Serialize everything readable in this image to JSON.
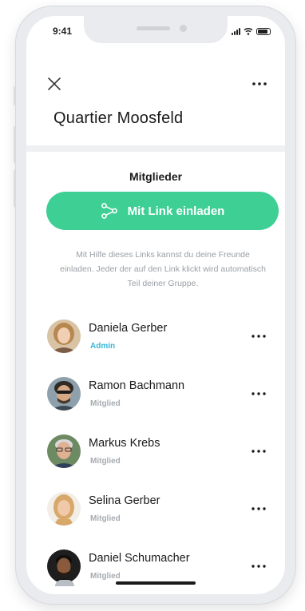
{
  "status_bar": {
    "time": "9:41"
  },
  "header": {
    "title": "Quartier Moosfeld"
  },
  "section": {
    "title": "Mitglieder"
  },
  "invite": {
    "label": "Mit Link einladen",
    "hint": "Mit Hilfe dieses Links kannst du deine Freunde einladen. Jeder der auf den Link klickt wird automatisch Teil deiner Gruppe."
  },
  "members": [
    {
      "name": "Daniela Gerber",
      "role": "Admin"
    },
    {
      "name": "Ramon Bachmann",
      "role": "Mitglied"
    },
    {
      "name": "Markus Krebs",
      "role": "Mitglied"
    },
    {
      "name": "Selina Gerber",
      "role": "Mitglied"
    },
    {
      "name": "Daniel Schumacher",
      "role": "Mitglied"
    }
  ],
  "colors": {
    "accent": "#3ecf95",
    "admin_role": "#37b7d8",
    "member_role": "#a6abb0"
  },
  "icons": {
    "close": "close-icon",
    "more": "more-horizontal-icon",
    "share": "share-link-icon"
  }
}
